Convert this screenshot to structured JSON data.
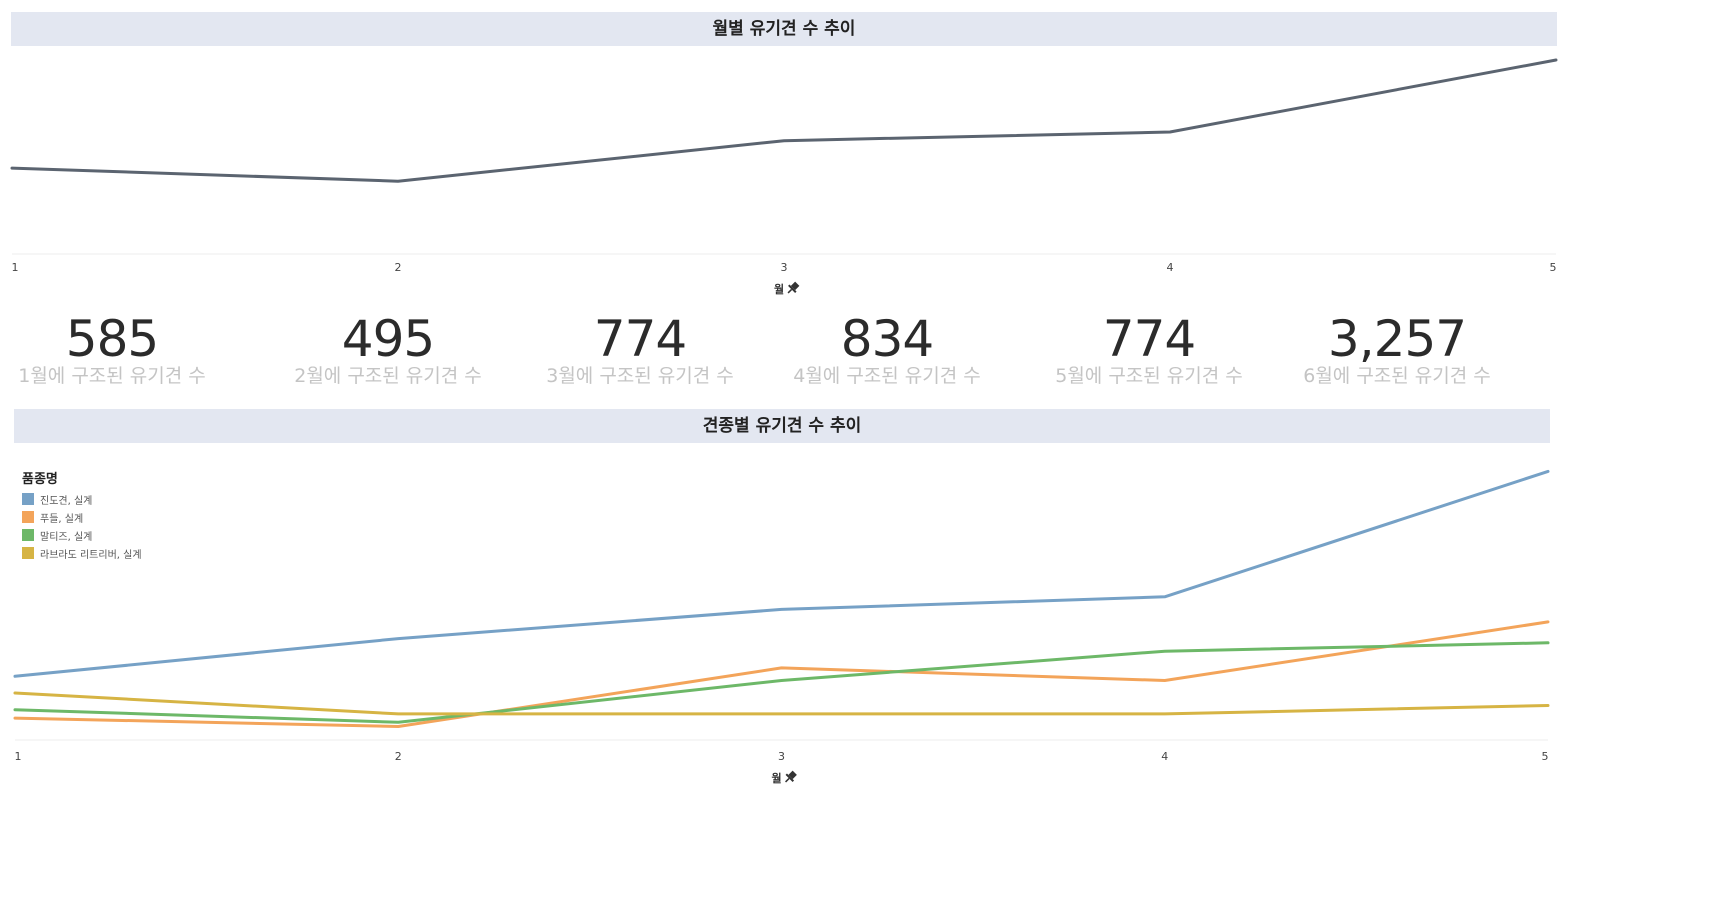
{
  "chart_data": [
    {
      "type": "line",
      "title": "월별 유기견 수 추이",
      "xlabel": "월",
      "x": [
        1,
        2,
        3,
        4,
        5
      ],
      "series": [
        {
          "values": [
            585,
            495,
            774,
            834,
            1330
          ],
          "color": "#5b6470"
        }
      ],
      "ylim": [
        0,
        1330
      ],
      "grid": false
    },
    {
      "type": "line",
      "title": "견종별 유기견 수 추이",
      "xlabel": "월",
      "legend_title": "품종명",
      "legend_position": "top-left",
      "x": [
        1,
        2,
        3,
        4,
        5
      ],
      "series": [
        {
          "name": "진도견, 실계",
          "color": "#76a1c6",
          "values": [
            165,
            210,
            245,
            260,
            410
          ]
        },
        {
          "name": "푸들, 실계",
          "color": "#f3a45a",
          "values": [
            115,
            105,
            175,
            160,
            230
          ]
        },
        {
          "name": "말티즈, 실계",
          "color": "#6db868",
          "values": [
            125,
            110,
            160,
            195,
            205
          ]
        },
        {
          "name": "라브라도 리트리버, 실계",
          "color": "#d6b444",
          "values": [
            145,
            120,
            120,
            120,
            130
          ]
        }
      ],
      "ylim": [
        90,
        420
      ],
      "grid": false
    }
  ],
  "kpis": [
    {
      "value": "585",
      "label": "1월에 구조된 유기견 수"
    },
    {
      "value": "495",
      "label": "2월에 구조된 유기견 수"
    },
    {
      "value": "774",
      "label": "3월에 구조된 유기견 수"
    },
    {
      "value": "834",
      "label": "4월에 구조된 유기견 수"
    },
    {
      "value": "774",
      "label": "5월에 구조된 유기견 수"
    },
    {
      "value": "3,257",
      "label": "6월에 구조된 유기견 수"
    }
  ],
  "icons": {
    "pin": "pin-icon"
  }
}
